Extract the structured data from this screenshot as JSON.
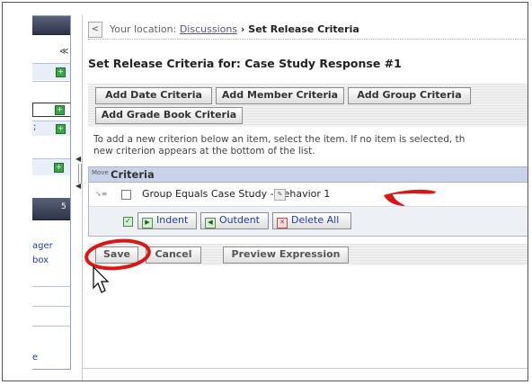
{
  "left_nav": {
    "links": [
      "ager",
      "box"
    ],
    "bottom_link": "e"
  },
  "breadcrumb": {
    "back_label": "<",
    "prefix": "Your location: ",
    "link": "Discussions",
    "separator": " › ",
    "current": "Set Release Criteria"
  },
  "page_title": "Set Release Criteria for: Case Study Response #1",
  "criteria_buttons": {
    "date": "Add Date Criteria",
    "member": "Add Member Criteria",
    "group": "Add Group Criteria",
    "gradebook": "Add Grade Book Criteria"
  },
  "info_text": {
    "line1": "To add a new criterion below an item, select the item. If no item is selected, th",
    "line2": "new criterion appears at the bottom of the list."
  },
  "criteria_table": {
    "move_header": "Move",
    "criteria_header": "Criteria",
    "rows": [
      {
        "text": "Group Equals Case Study - Behavior 1"
      }
    ],
    "indent_label": "Indent",
    "outdent_label": "Outdent",
    "delete_all_label": "Delete All"
  },
  "actions": {
    "save": "Save",
    "cancel": "Cancel",
    "preview": "Preview Expression"
  },
  "annotations": {
    "arrow_color": "#d81818",
    "circle_color": "#d81818"
  }
}
